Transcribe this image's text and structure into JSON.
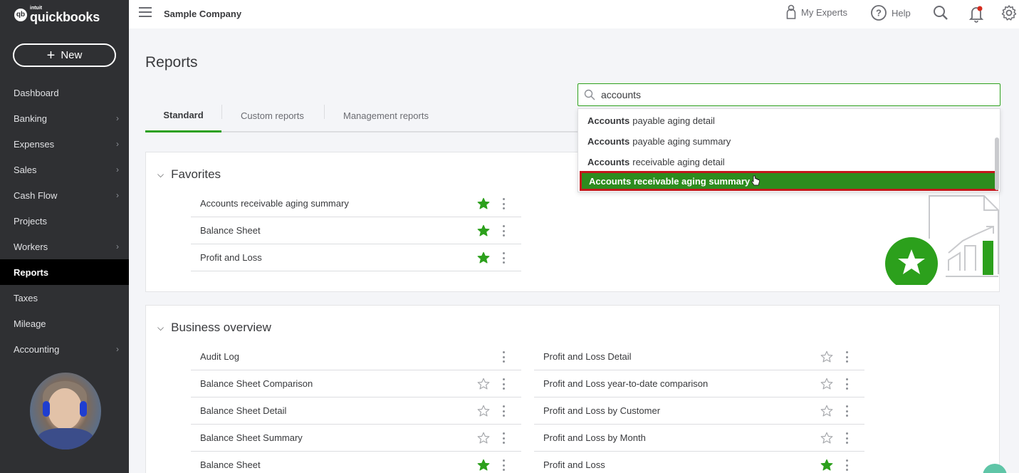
{
  "app": {
    "logo_small": "intuit",
    "logo_main": "quickbooks",
    "logo_badge": "qb"
  },
  "sidebar": {
    "new_label": "New",
    "items": [
      {
        "label": "Dashboard",
        "chevron": false,
        "active": false
      },
      {
        "label": "Banking",
        "chevron": true,
        "active": false
      },
      {
        "label": "Expenses",
        "chevron": true,
        "active": false
      },
      {
        "label": "Sales",
        "chevron": true,
        "active": false
      },
      {
        "label": "Cash Flow",
        "chevron": true,
        "active": false
      },
      {
        "label": "Projects",
        "chevron": false,
        "active": false
      },
      {
        "label": "Workers",
        "chevron": true,
        "active": false
      },
      {
        "label": "Reports",
        "chevron": false,
        "active": true
      },
      {
        "label": "Taxes",
        "chevron": false,
        "active": false
      },
      {
        "label": "Mileage",
        "chevron": false,
        "active": false
      },
      {
        "label": "Accounting",
        "chevron": true,
        "active": false
      }
    ]
  },
  "topbar": {
    "company": "Sample Company",
    "my_experts": "My Experts",
    "help": "Help"
  },
  "page": {
    "title": "Reports"
  },
  "tabs": [
    "Standard",
    "Custom reports",
    "Management reports"
  ],
  "search": {
    "value": "accounts",
    "suggestions": [
      {
        "bold": "Accounts",
        "rest": "payable aging detail"
      },
      {
        "bold": "Accounts",
        "rest": "payable aging summary"
      },
      {
        "bold": "Accounts",
        "rest": "receivable aging detail"
      },
      {
        "bold": "",
        "rest": "Accounts receivable aging summary"
      }
    ]
  },
  "favorites": {
    "title": "Favorites",
    "rows": [
      {
        "label": "Accounts receivable aging summary",
        "starred": true
      },
      {
        "label": "Balance Sheet",
        "starred": true
      },
      {
        "label": "Profit and Loss",
        "starred": true
      }
    ]
  },
  "business_overview": {
    "title": "Business overview",
    "left": [
      {
        "label": "Audit Log",
        "starred": null
      },
      {
        "label": "Balance Sheet Comparison",
        "starred": false
      },
      {
        "label": "Balance Sheet Detail",
        "starred": false
      },
      {
        "label": "Balance Sheet Summary",
        "starred": false
      },
      {
        "label": "Balance Sheet",
        "starred": true
      }
    ],
    "right": [
      {
        "label": "Profit and Loss Detail",
        "starred": false
      },
      {
        "label": "Profit and Loss year-to-date comparison",
        "starred": false
      },
      {
        "label": "Profit and Loss by Customer",
        "starred": false
      },
      {
        "label": "Profit and Loss by Month",
        "starred": false
      },
      {
        "label": "Profit and Loss",
        "starred": true
      }
    ]
  },
  "colors": {
    "accent": "#2ca01c",
    "highlight": "#2d8c1e",
    "outline": "#c4161c",
    "sidebar": "#2f3033"
  }
}
